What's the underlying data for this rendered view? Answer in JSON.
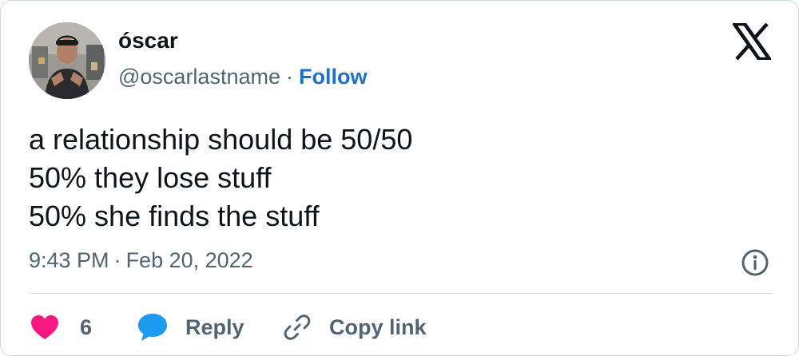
{
  "author": {
    "display_name": "óscar",
    "handle": "@oscarlastname",
    "separator": "·",
    "follow_label": "Follow"
  },
  "tweet": {
    "lines": [
      "a relationship should be 50/50",
      "50% they lose stuff",
      "50% she finds the stuff"
    ]
  },
  "meta": {
    "time": "9:43 PM",
    "separator": "·",
    "date": "Feb 20, 2022"
  },
  "actions": {
    "like_count": "6",
    "reply_label": "Reply",
    "copy_link_label": "Copy link"
  },
  "icons": {
    "brand": "x-logo-icon",
    "info": "info-icon",
    "like": "heart-icon",
    "reply": "speech-bubble-icon",
    "copy": "link-icon"
  },
  "colors": {
    "text": "#0f1419",
    "secondary": "#536471",
    "follow": "#1d72c7",
    "heart": "#f91880",
    "reply_bubble": "#1d9bf0",
    "border": "#cfd9de"
  }
}
